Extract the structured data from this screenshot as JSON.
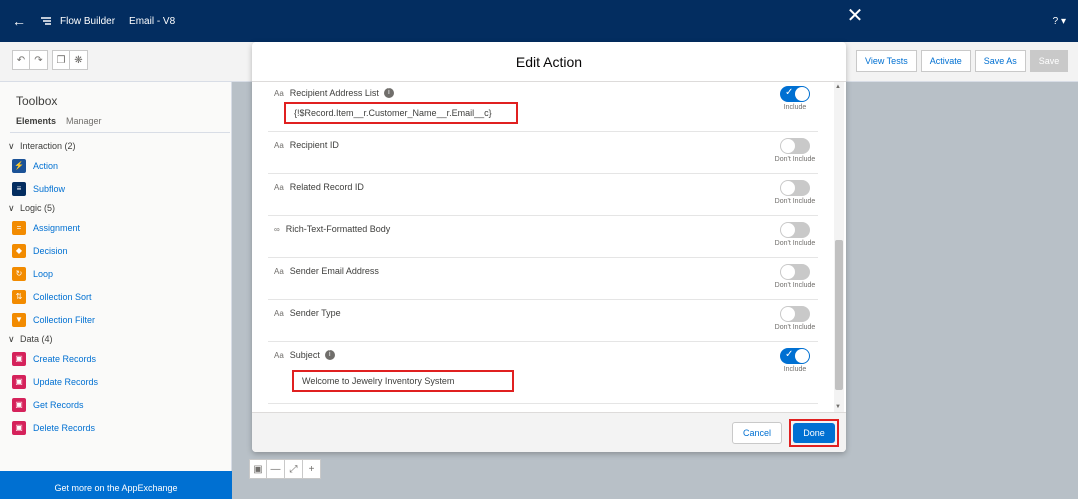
{
  "topbar": {
    "back_icon": "arrow-left-icon",
    "app_name": "Flow Builder",
    "flow_name": "Email - V8",
    "help": "? ▾"
  },
  "toolbar": {
    "undo_icon": "undo-icon",
    "redo_icon": "redo-icon",
    "copy_icon": "copy-icon",
    "settings_icon": "gear-icon",
    "buttons": [
      "View Tests",
      "Activate",
      "Save As",
      "Save"
    ]
  },
  "sidebar": {
    "title": "Toolbox",
    "tabs": [
      "Elements",
      "Manager"
    ],
    "sections": [
      {
        "label": "Interaction (2)",
        "items": [
          {
            "label": "Action",
            "color": "#1b5297",
            "glyph": "⚡"
          },
          {
            "label": "Subflow",
            "color": "#032d60",
            "glyph": "≡"
          }
        ]
      },
      {
        "label": "Logic (5)",
        "items": [
          {
            "label": "Assignment",
            "color": "#f28b00",
            "glyph": "="
          },
          {
            "label": "Decision",
            "color": "#f28b00",
            "glyph": "◆"
          },
          {
            "label": "Loop",
            "color": "#f28b00",
            "glyph": "↻"
          },
          {
            "label": "Collection Sort",
            "color": "#f28b00",
            "glyph": "⇅"
          },
          {
            "label": "Collection Filter",
            "color": "#f28b00",
            "glyph": "▼"
          }
        ]
      },
      {
        "label": "Data (4)",
        "items": [
          {
            "label": "Create Records",
            "color": "#d5225b",
            "glyph": "▣"
          },
          {
            "label": "Update Records",
            "color": "#d5225b",
            "glyph": "▣"
          },
          {
            "label": "Get Records",
            "color": "#d5225b",
            "glyph": "▣"
          },
          {
            "label": "Delete Records",
            "color": "#d5225b",
            "glyph": "▣"
          }
        ]
      }
    ],
    "footer": "Get more on the AppExchange"
  },
  "modal": {
    "title": "Edit Action",
    "close_icon": "close-icon",
    "rows": [
      {
        "type": "Aa",
        "label": "Recipient Address List",
        "info": true,
        "on": true,
        "caption": "Include",
        "value": "{!$Record.Item__r.Customer_Name__r.Email__c}"
      },
      {
        "type": "Aa",
        "label": "Recipient ID",
        "info": false,
        "on": false,
        "caption": "Don't Include",
        "value": ""
      },
      {
        "type": "Aa",
        "label": "Related Record ID",
        "info": false,
        "on": false,
        "caption": "Don't Include",
        "value": ""
      },
      {
        "type": "∞",
        "label": "Rich-Text-Formatted Body",
        "info": false,
        "on": false,
        "caption": "Don't Include",
        "value": ""
      },
      {
        "type": "Aa",
        "label": "Sender Email Address",
        "info": false,
        "on": false,
        "caption": "Don't Include",
        "value": ""
      },
      {
        "type": "Aa",
        "label": "Sender Type",
        "info": false,
        "on": false,
        "caption": "Don't Include",
        "value": ""
      },
      {
        "type": "Aa",
        "label": "Subject",
        "info": true,
        "on": true,
        "caption": "Include",
        "value": "Welcome to Jewelry Inventory System"
      }
    ],
    "cancel_label": "Cancel",
    "done_label": "Done"
  },
  "canvas": {
    "fit_icon": "fit-icon",
    "zoom_out": "—",
    "expand_icon": "expand-icon",
    "zoom_in": "+"
  }
}
